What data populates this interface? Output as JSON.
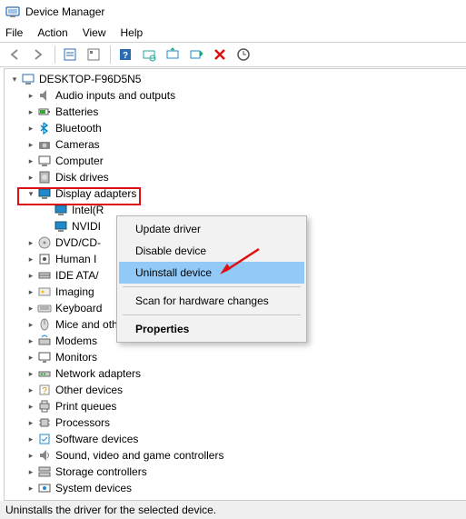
{
  "window": {
    "title": "Device Manager"
  },
  "menu": {
    "file": "File",
    "action": "Action",
    "view": "View",
    "help": "Help"
  },
  "toolbar_icons": {
    "back": "back-icon",
    "forward": "forward-icon",
    "show_hidden": "show-hidden-icon",
    "properties": "properties-icon",
    "help": "help-icon",
    "scan": "scan-icon",
    "update": "update-icon",
    "enable": "enable-icon",
    "uninstall": "uninstall-icon",
    "legacy": "legacy-icon"
  },
  "tree": {
    "root": "DESKTOP-F96D5N5",
    "items": [
      {
        "label": "Audio inputs and outputs",
        "icon": "audio-icon"
      },
      {
        "label": "Batteries",
        "icon": "battery-icon"
      },
      {
        "label": "Bluetooth",
        "icon": "bluetooth-icon"
      },
      {
        "label": "Cameras",
        "icon": "camera-icon"
      },
      {
        "label": "Computer",
        "icon": "computer-icon"
      },
      {
        "label": "Disk drives",
        "icon": "disk-icon"
      },
      {
        "label": "Display adapters",
        "icon": "display-icon",
        "expanded": true,
        "children": [
          {
            "label": "Intel(R",
            "icon": "display-icon"
          },
          {
            "label": "NVIDI",
            "icon": "display-icon"
          }
        ]
      },
      {
        "label": "DVD/CD-",
        "icon": "dvd-icon"
      },
      {
        "label": "Human I",
        "icon": "hid-icon"
      },
      {
        "label": "IDE ATA/",
        "icon": "ide-icon"
      },
      {
        "label": "Imaging ",
        "icon": "imaging-icon"
      },
      {
        "label": "Keyboard",
        "icon": "keyboard-icon"
      },
      {
        "label": "Mice and other pointing devices",
        "icon": "mouse-icon"
      },
      {
        "label": "Modems",
        "icon": "modem-icon"
      },
      {
        "label": "Monitors",
        "icon": "monitor-icon"
      },
      {
        "label": "Network adapters",
        "icon": "network-icon"
      },
      {
        "label": "Other devices",
        "icon": "other-icon"
      },
      {
        "label": "Print queues",
        "icon": "printer-icon"
      },
      {
        "label": "Processors",
        "icon": "cpu-icon"
      },
      {
        "label": "Software devices",
        "icon": "software-icon"
      },
      {
        "label": "Sound, video and game controllers",
        "icon": "sound-icon"
      },
      {
        "label": "Storage controllers",
        "icon": "storage-icon"
      },
      {
        "label": "System devices",
        "icon": "system-icon"
      }
    ]
  },
  "context_menu": {
    "items": [
      {
        "label": "Update driver",
        "hover": false
      },
      {
        "label": "Disable device",
        "hover": false
      },
      {
        "label": "Uninstall device",
        "hover": true
      },
      {
        "sep": true
      },
      {
        "label": "Scan for hardware changes",
        "hover": false
      },
      {
        "sep": true
      },
      {
        "label": "Properties",
        "hover": false,
        "bold": true
      }
    ]
  },
  "status": {
    "text": "Uninstalls the driver for the selected device."
  },
  "colors": {
    "highlight": "#91c9f7",
    "red": "#d11"
  }
}
